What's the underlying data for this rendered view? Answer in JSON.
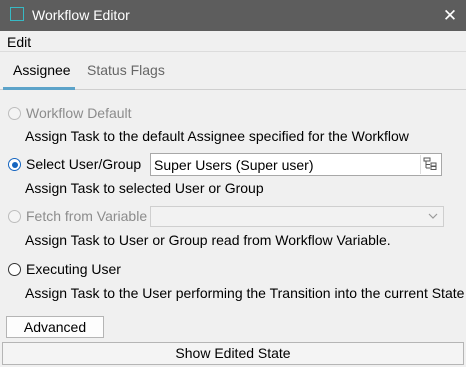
{
  "window": {
    "title": "Workflow Editor",
    "close_glyph": "✕"
  },
  "menu": {
    "edit": "Edit"
  },
  "tabs": [
    {
      "label": "Assignee",
      "active": true
    },
    {
      "label": "Status Flags",
      "active": false
    }
  ],
  "options": [
    {
      "label": "Workflow Default",
      "checked": false,
      "enabled": false,
      "description": "Assign Task to the default Assignee specified for the Workflow"
    },
    {
      "label": "Select User/Group",
      "checked": true,
      "enabled": true,
      "description": "Assign Task to selected User or Group"
    },
    {
      "label": "Fetch from Variable",
      "checked": false,
      "enabled": false,
      "description": "Assign Task to User or Group read from Workflow Variable."
    },
    {
      "label": "Executing User",
      "checked": false,
      "enabled": true,
      "description": "Assign Task to the User performing the Transition into the current State"
    }
  ],
  "user_group_field": {
    "value": "Super Users (Super user)"
  },
  "variable_combo": {
    "value": ""
  },
  "buttons": {
    "advanced": "Advanced",
    "show_edited_state": "Show Edited State"
  },
  "colors": {
    "titlebar": "#5d5d5d",
    "accent": "#1565c0",
    "tab_underline": "#5ca3c9",
    "title_icon": "#37b9c4"
  }
}
